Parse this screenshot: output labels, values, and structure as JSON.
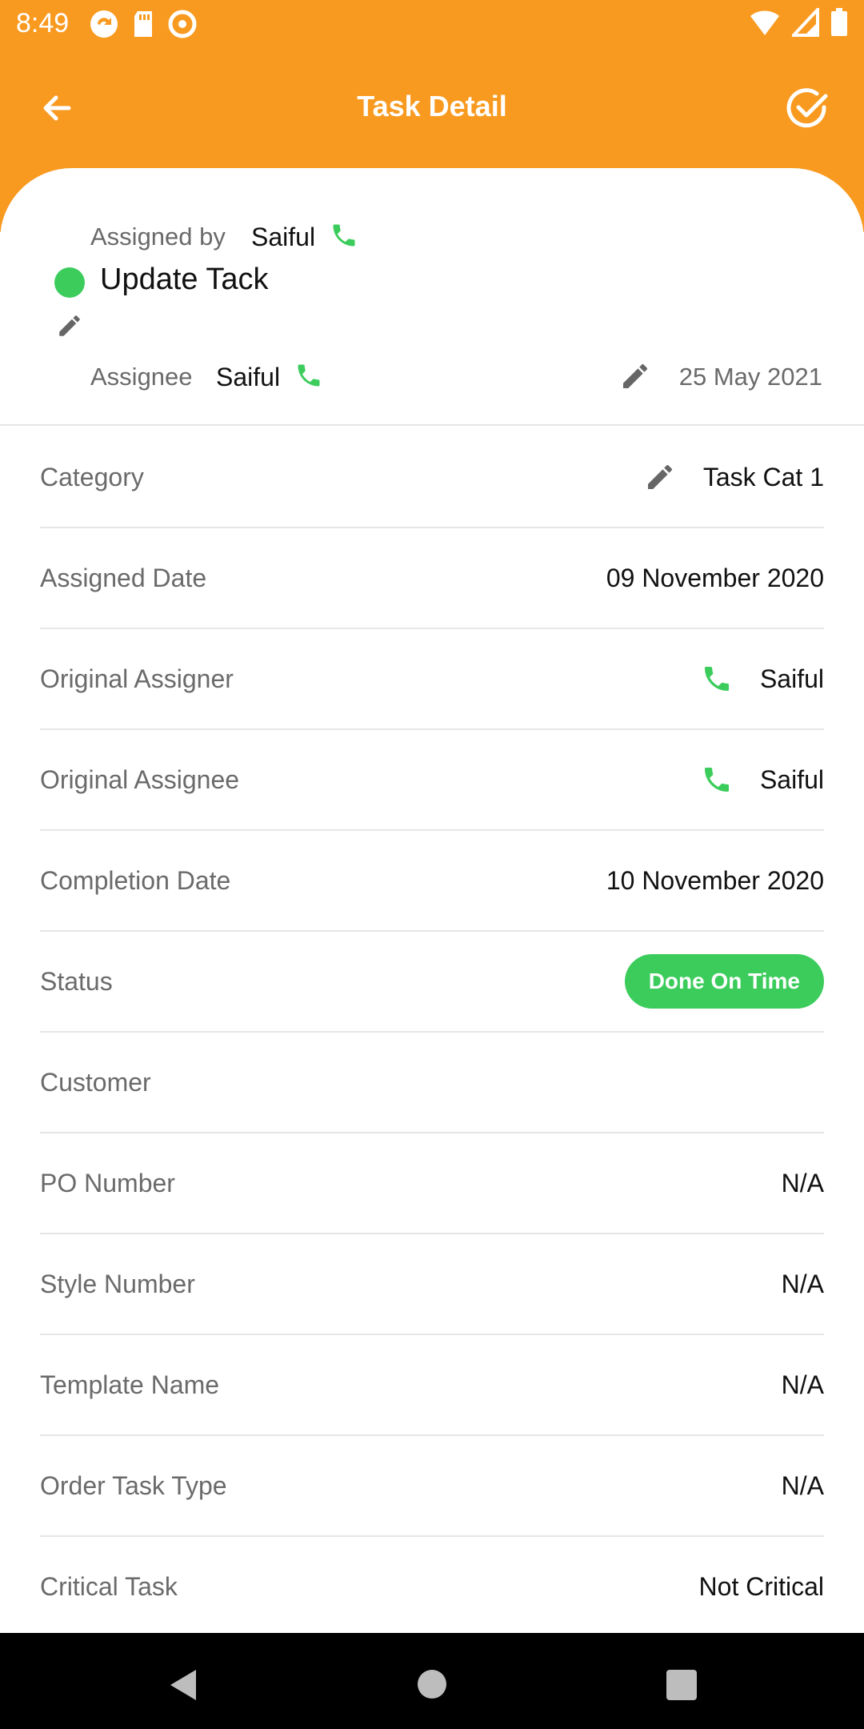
{
  "status_bar": {
    "time": "8:49",
    "left_icons": [
      "sync-icon",
      "sd-card-icon",
      "at-sign-icon"
    ],
    "right_icons": [
      "wifi-icon",
      "cell-signal-icon",
      "battery-icon"
    ]
  },
  "app_bar": {
    "title": "Task Detail",
    "back_icon": "arrow-left-icon",
    "action_icon": "check-circle-icon",
    "color": "#f99a20"
  },
  "header": {
    "assigned_by_label": "Assigned by",
    "assigned_by_name": "Saiful",
    "task_title": "Update Tack",
    "assignee_label": "Assignee",
    "assignee_name": "Saiful",
    "due_date": "25 May 2021",
    "status_color": "#3ccc5c"
  },
  "details": {
    "rows": [
      {
        "label": "Category",
        "value": "Task Cat 1"
      },
      {
        "label": "Assigned Date",
        "value": "09 November 2020"
      },
      {
        "label": "Original Assigner",
        "value": "Saiful"
      },
      {
        "label": "Original Assignee",
        "value": "Saiful"
      },
      {
        "label": "Completion Date",
        "value": "10 November 2020"
      },
      {
        "label": "Status",
        "value": "Done On Time"
      },
      {
        "label": "Customer",
        "value": ""
      },
      {
        "label": "PO Number",
        "value": "N/A"
      },
      {
        "label": "Style Number",
        "value": "N/A"
      },
      {
        "label": "Template Name",
        "value": "N/A"
      },
      {
        "label": "Order Task Type",
        "value": "N/A"
      },
      {
        "label": "Critical Task",
        "value": "Not Critical"
      }
    ]
  },
  "colors": {
    "accent": "#f99a20",
    "success": "#3ccc5c",
    "label": "#6a6a6a",
    "text": "#111111"
  }
}
